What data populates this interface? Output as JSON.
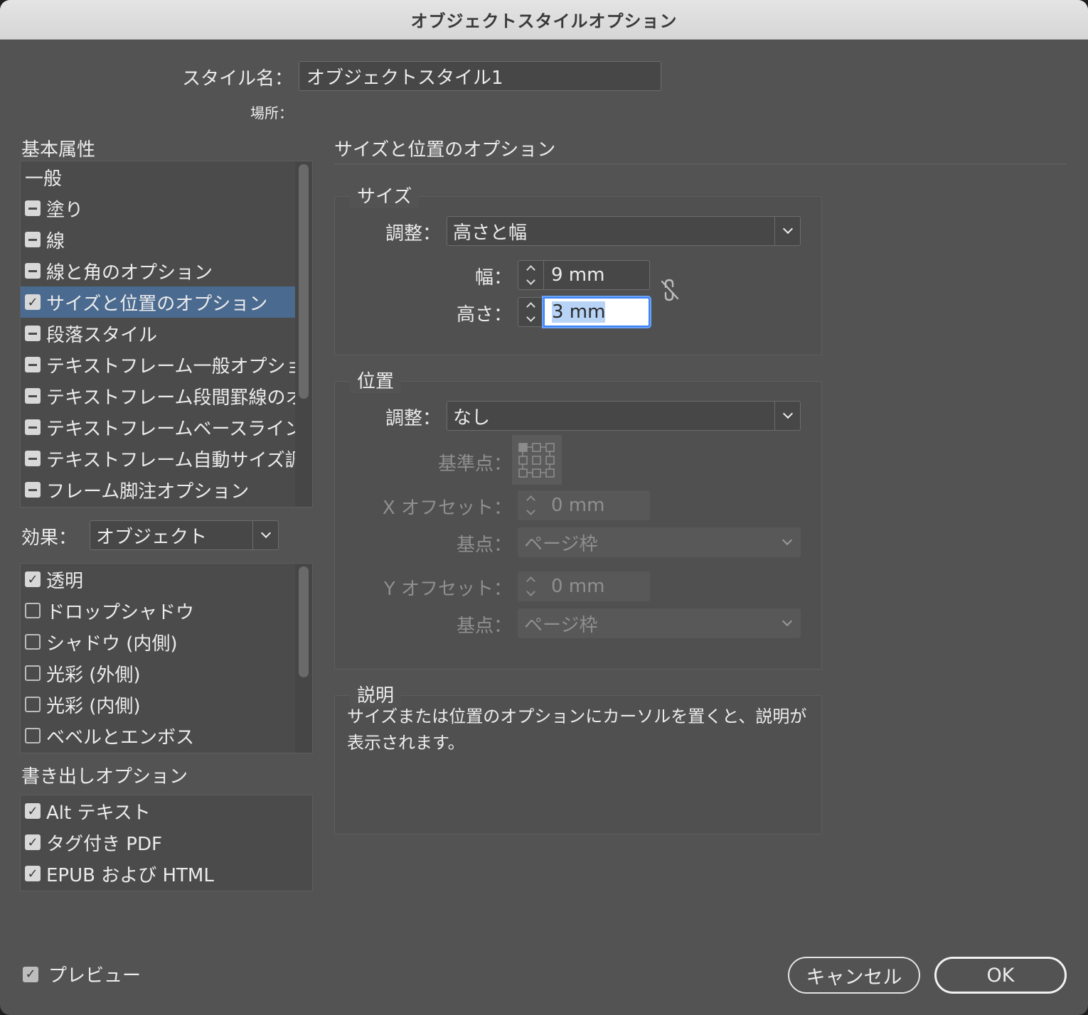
{
  "window": {
    "title": "オブジェクトスタイルオプション"
  },
  "style_name": {
    "label": "スタイル名：",
    "value": "オブジェクトスタイル1"
  },
  "location": {
    "label": "場所："
  },
  "basic": {
    "title": "基本属性",
    "items": [
      {
        "label": "一般",
        "state": "none"
      },
      {
        "label": "塗り",
        "state": "minus"
      },
      {
        "label": "線",
        "state": "minus"
      },
      {
        "label": "線と角のオプション",
        "state": "minus"
      },
      {
        "label": "サイズと位置のオプション",
        "state": "check",
        "selected": true
      },
      {
        "label": "段落スタイル",
        "state": "minus"
      },
      {
        "label": "テキストフレーム一般オプショ",
        "state": "minus"
      },
      {
        "label": "テキストフレーム段間罫線のオ",
        "state": "minus"
      },
      {
        "label": "テキストフレームベースライン",
        "state": "minus"
      },
      {
        "label": "テキストフレーム自動サイズ調",
        "state": "minus"
      },
      {
        "label": "フレーム脚注オプション",
        "state": "minus"
      }
    ]
  },
  "effects": {
    "label": "効果：",
    "target": "オブジェクト",
    "items": [
      {
        "label": "透明",
        "checked": true
      },
      {
        "label": "ドロップシャドウ",
        "checked": false
      },
      {
        "label": "シャドウ (内側)",
        "checked": false
      },
      {
        "label": "光彩 (外側)",
        "checked": false
      },
      {
        "label": "光彩 (内側)",
        "checked": false
      },
      {
        "label": "ベベルとエンボス",
        "checked": false
      }
    ]
  },
  "export": {
    "title": "書き出しオプション",
    "items": [
      {
        "label": "Alt テキスト",
        "checked": true
      },
      {
        "label": "タグ付き PDF",
        "checked": true
      },
      {
        "label": "EPUB および HTML",
        "checked": true
      }
    ]
  },
  "panel": {
    "title": "サイズと位置のオプション",
    "size": {
      "title": "サイズ",
      "adjust_label": "調整：",
      "adjust_value": "高さと幅",
      "width_label": "幅：",
      "width_value": "9 mm",
      "height_label": "高さ：",
      "height_value": "3 mm"
    },
    "position": {
      "title": "位置",
      "adjust_label": "調整：",
      "adjust_value": "なし",
      "ref_label": "基準点：",
      "x_label": "X オフセット：",
      "x_value": "0 mm",
      "x_base_label": "基点：",
      "x_base_value": "ページ枠",
      "y_label": "Y オフセット：",
      "y_value": "0 mm",
      "y_base_label": "基点：",
      "y_base_value": "ページ枠"
    },
    "description": {
      "title": "説明",
      "line1": "サイズまたは位置のオプションにカーソルを置くと、説明が",
      "line2": "表示されます。"
    }
  },
  "preview": {
    "label": "プレビュー",
    "checked": true
  },
  "buttons": {
    "cancel": "キャンセル",
    "ok": "OK"
  },
  "icons": {
    "link": "unlink-chain-icon",
    "checkmark": "✓"
  }
}
